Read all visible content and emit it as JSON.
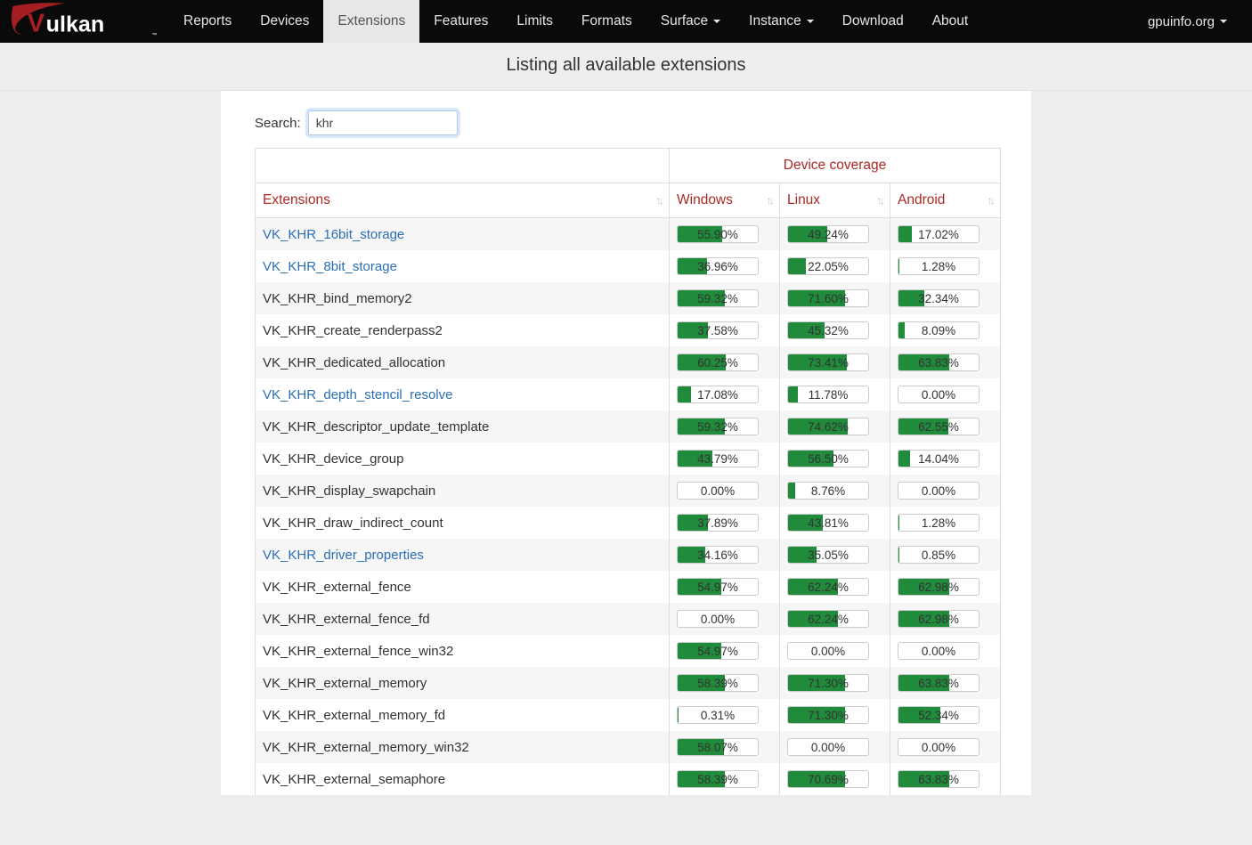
{
  "brand": {
    "site_label": "gpuinfo.org"
  },
  "nav": {
    "items": [
      {
        "label": "Reports",
        "active": false,
        "dropdown": false
      },
      {
        "label": "Devices",
        "active": false,
        "dropdown": false
      },
      {
        "label": "Extensions",
        "active": true,
        "dropdown": false
      },
      {
        "label": "Features",
        "active": false,
        "dropdown": false
      },
      {
        "label": "Limits",
        "active": false,
        "dropdown": false
      },
      {
        "label": "Formats",
        "active": false,
        "dropdown": false
      },
      {
        "label": "Surface",
        "active": false,
        "dropdown": true
      },
      {
        "label": "Instance",
        "active": false,
        "dropdown": true
      },
      {
        "label": "Download",
        "active": false,
        "dropdown": false
      },
      {
        "label": "About",
        "active": false,
        "dropdown": false
      }
    ]
  },
  "subheader": "Listing all available extensions",
  "search": {
    "label": "Search:",
    "value": "khr"
  },
  "table": {
    "group_header": "Device coverage",
    "columns": {
      "extensions": "Extensions",
      "windows": "Windows",
      "linux": "Linux",
      "android": "Android"
    },
    "rows": [
      {
        "name": "VK_KHR_16bit_storage",
        "link": true,
        "windows": 55.9,
        "linux": 49.24,
        "android": 17.02
      },
      {
        "name": "VK_KHR_8bit_storage",
        "link": true,
        "windows": 36.96,
        "linux": 22.05,
        "android": 1.28
      },
      {
        "name": "VK_KHR_bind_memory2",
        "link": false,
        "windows": 59.32,
        "linux": 71.6,
        "android": 32.34
      },
      {
        "name": "VK_KHR_create_renderpass2",
        "link": false,
        "windows": 37.58,
        "linux": 45.32,
        "android": 8.09
      },
      {
        "name": "VK_KHR_dedicated_allocation",
        "link": false,
        "windows": 60.25,
        "linux": 73.41,
        "android": 63.83
      },
      {
        "name": "VK_KHR_depth_stencil_resolve",
        "link": true,
        "windows": 17.08,
        "linux": 11.78,
        "android": 0.0
      },
      {
        "name": "VK_KHR_descriptor_update_template",
        "link": false,
        "windows": 59.32,
        "linux": 74.62,
        "android": 62.55
      },
      {
        "name": "VK_KHR_device_group",
        "link": false,
        "windows": 43.79,
        "linux": 56.5,
        "android": 14.04
      },
      {
        "name": "VK_KHR_display_swapchain",
        "link": false,
        "windows": 0.0,
        "linux": 8.76,
        "android": 0.0
      },
      {
        "name": "VK_KHR_draw_indirect_count",
        "link": false,
        "windows": 37.89,
        "linux": 43.81,
        "android": 1.28
      },
      {
        "name": "VK_KHR_driver_properties",
        "link": true,
        "windows": 34.16,
        "linux": 35.05,
        "android": 0.85
      },
      {
        "name": "VK_KHR_external_fence",
        "link": false,
        "windows": 54.97,
        "linux": 62.24,
        "android": 62.98
      },
      {
        "name": "VK_KHR_external_fence_fd",
        "link": false,
        "windows": 0.0,
        "linux": 62.24,
        "android": 62.98
      },
      {
        "name": "VK_KHR_external_fence_win32",
        "link": false,
        "windows": 54.97,
        "linux": 0.0,
        "android": 0.0
      },
      {
        "name": "VK_KHR_external_memory",
        "link": false,
        "windows": 58.39,
        "linux": 71.3,
        "android": 63.83
      },
      {
        "name": "VK_KHR_external_memory_fd",
        "link": false,
        "windows": 0.31,
        "linux": 71.3,
        "android": 52.34
      },
      {
        "name": "VK_KHR_external_memory_win32",
        "link": false,
        "windows": 58.07,
        "linux": 0.0,
        "android": 0.0
      },
      {
        "name": "VK_KHR_external_semaphore",
        "link": false,
        "windows": 58.39,
        "linux": 70.69,
        "android": 63.83
      }
    ]
  },
  "chart_data": {
    "type": "table",
    "title": "Device coverage",
    "columns": [
      "Extensions",
      "Windows",
      "Linux",
      "Android"
    ],
    "unit": "percent",
    "rows": [
      [
        "VK_KHR_16bit_storage",
        55.9,
        49.24,
        17.02
      ],
      [
        "VK_KHR_8bit_storage",
        36.96,
        22.05,
        1.28
      ],
      [
        "VK_KHR_bind_memory2",
        59.32,
        71.6,
        32.34
      ],
      [
        "VK_KHR_create_renderpass2",
        37.58,
        45.32,
        8.09
      ],
      [
        "VK_KHR_dedicated_allocation",
        60.25,
        73.41,
        63.83
      ],
      [
        "VK_KHR_depth_stencil_resolve",
        17.08,
        11.78,
        0.0
      ],
      [
        "VK_KHR_descriptor_update_template",
        59.32,
        74.62,
        62.55
      ],
      [
        "VK_KHR_device_group",
        43.79,
        56.5,
        14.04
      ],
      [
        "VK_KHR_display_swapchain",
        0.0,
        8.76,
        0.0
      ],
      [
        "VK_KHR_draw_indirect_count",
        37.89,
        43.81,
        1.28
      ],
      [
        "VK_KHR_driver_properties",
        34.16,
        35.05,
        0.85
      ],
      [
        "VK_KHR_external_fence",
        54.97,
        62.24,
        62.98
      ],
      [
        "VK_KHR_external_fence_fd",
        0.0,
        62.24,
        62.98
      ],
      [
        "VK_KHR_external_fence_win32",
        54.97,
        0.0,
        0.0
      ],
      [
        "VK_KHR_external_memory",
        58.39,
        71.3,
        63.83
      ],
      [
        "VK_KHR_external_memory_fd",
        0.31,
        71.3,
        52.34
      ],
      [
        "VK_KHR_external_memory_win32",
        58.07,
        0.0,
        0.0
      ],
      [
        "VK_KHR_external_semaphore",
        58.39,
        70.69,
        63.83
      ]
    ]
  }
}
